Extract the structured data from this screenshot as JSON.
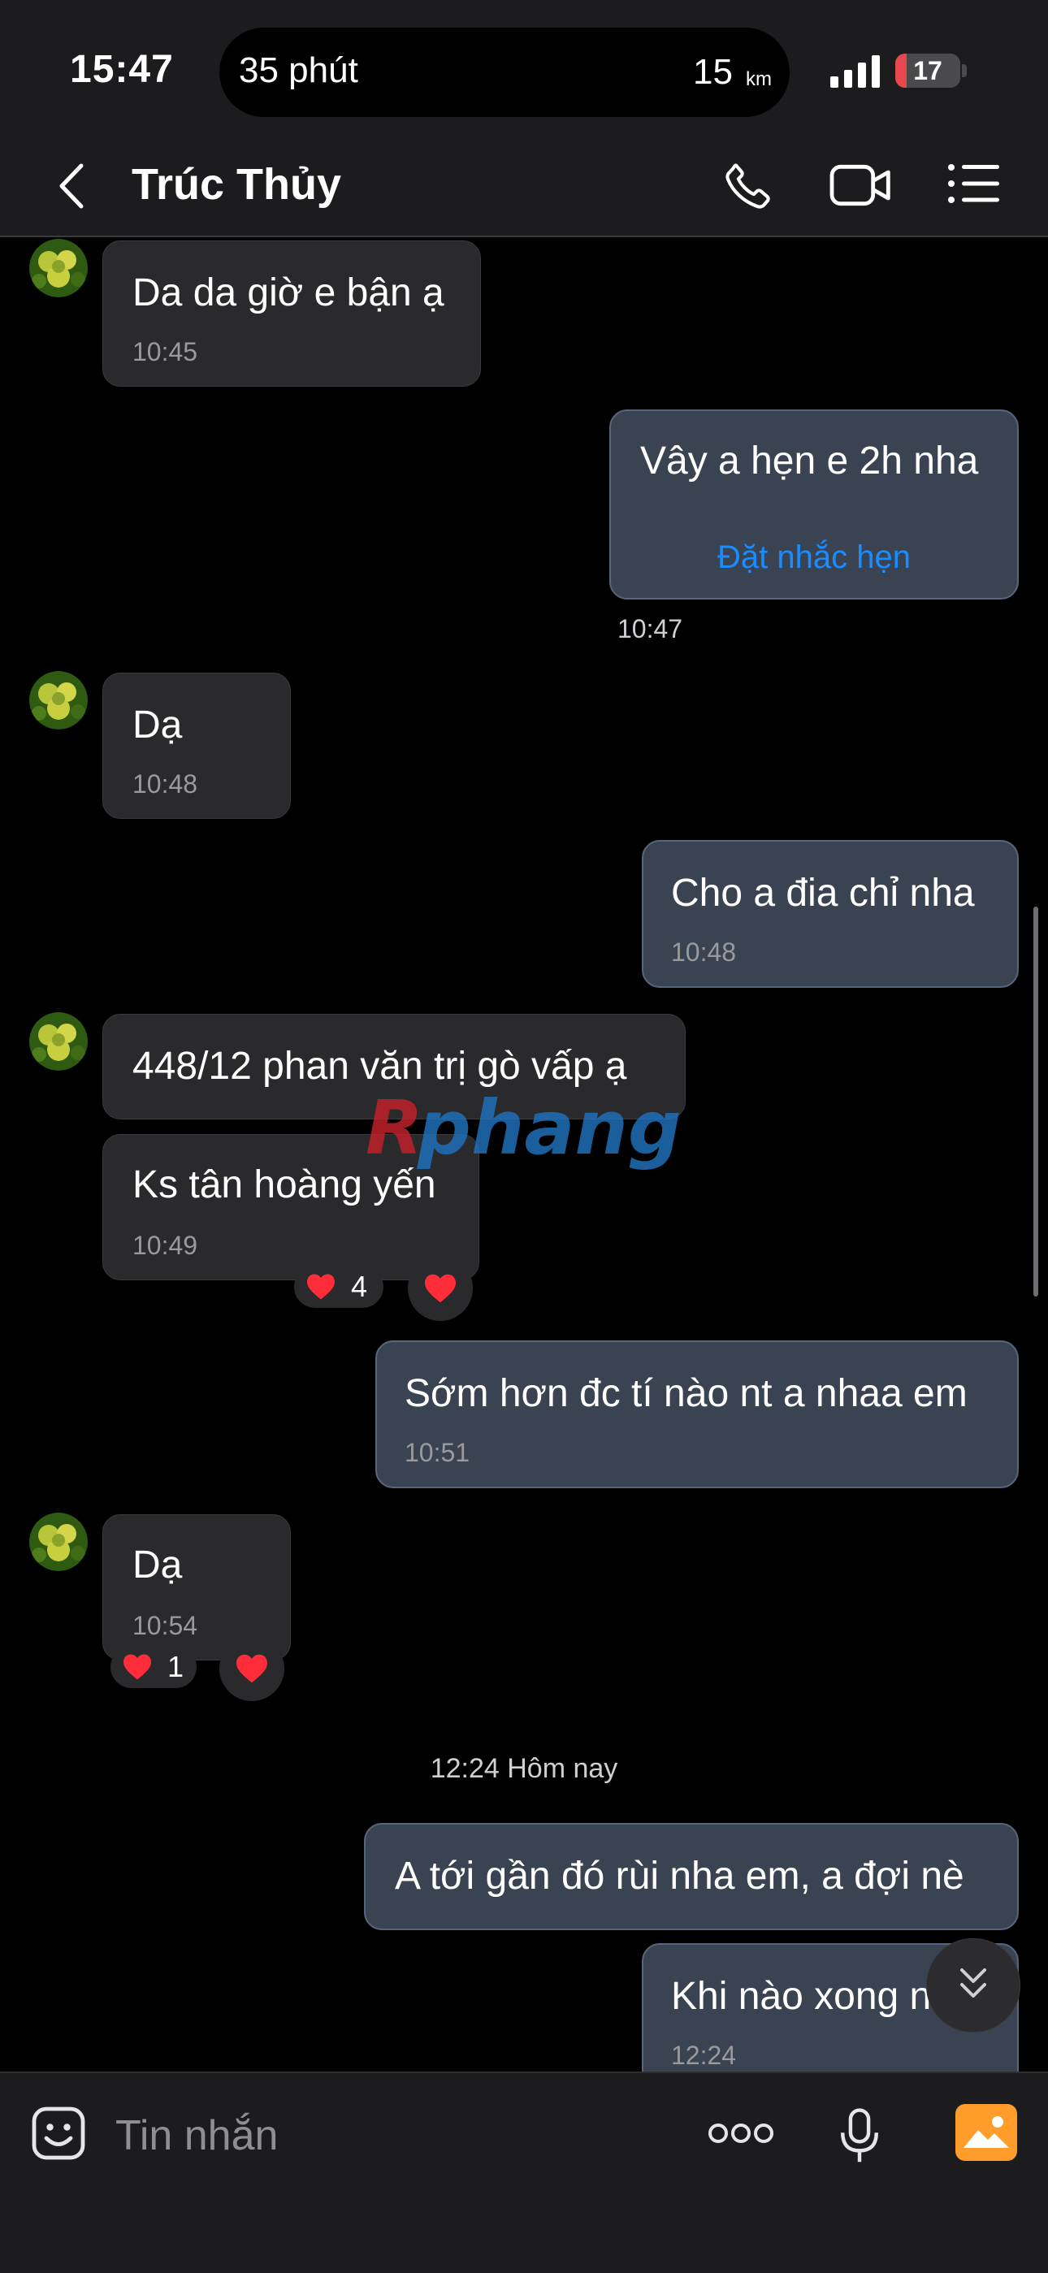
{
  "status_bar": {
    "time": "15:47",
    "live_activity_left": "35 phút",
    "live_activity_right": "15",
    "live_activity_unit": "km",
    "battery_level": "17",
    "battery_fraction": 0.17
  },
  "header": {
    "contact_name": "Trúc Thủy"
  },
  "messages": [
    {
      "side": "incoming",
      "text": "Da da giờ e bận ạ",
      "time": "10:45"
    },
    {
      "side": "outgoing",
      "text": "Vây a hẹn e 2h nha",
      "action": "Đặt nhắc hẹn",
      "time": "10:47"
    },
    {
      "side": "incoming",
      "text": "Dạ",
      "time": "10:48"
    },
    {
      "side": "outgoing",
      "text": "Cho a đia chỉ nha",
      "time": "10:48"
    },
    {
      "side": "incoming",
      "text": "448/12 phan văn trị gò vấp ạ"
    },
    {
      "side": "incoming",
      "text": "Ks tân hoàng yến",
      "time": "10:49",
      "reaction_count": "4"
    },
    {
      "side": "outgoing",
      "text": "Sớm hơn đc tí nào nt a nhaa em",
      "time": "10:51"
    },
    {
      "side": "incoming",
      "text": "Dạ",
      "time": "10:54",
      "reaction_count": "1"
    },
    {
      "side": "outgoing",
      "text": "A tới gần đó rùi nha em, a đợi nè"
    },
    {
      "side": "outgoing",
      "text": "Khi nào xong n",
      "time": "12:24"
    }
  ],
  "date_separator": "12:24 Hôm nay",
  "watermark": "Rphang",
  "input": {
    "placeholder": "Tin nhắn"
  },
  "colors": {
    "accent_blue": "#1a8cff",
    "heart_red": "#ff2d3a",
    "outgoing_bubble": "#3a4351",
    "incoming_bubble": "#2a2a2c",
    "media_button": "#ff9c2a"
  }
}
